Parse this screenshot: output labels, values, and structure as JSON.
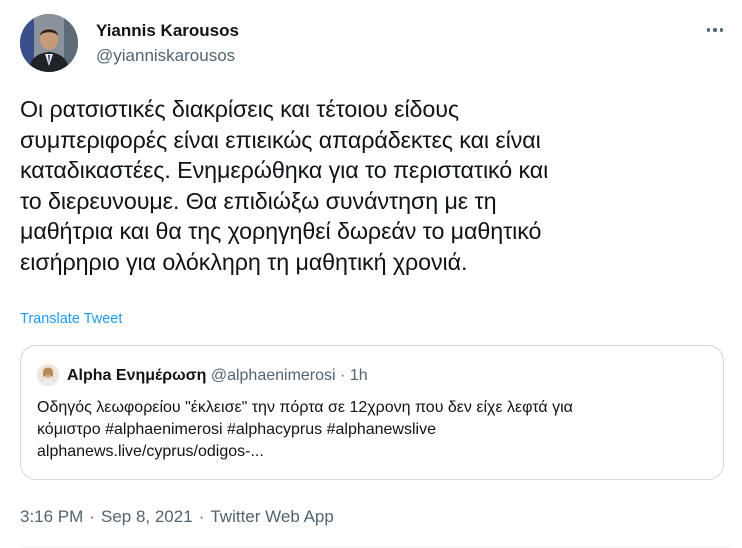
{
  "author": {
    "name": "Yiannis Karousos",
    "handle": "@yianniskarousos"
  },
  "tweet": {
    "text": "Οι ρατσιστικές διακρίσεις και τέτοιου είδους\nσυμπεριφορές είναι επιεικώς απαράδεκτες και είναι\nκαταδικαστέες. Ενημερώθηκα για το περιστατικό και\nτο διερευνουμε. Θα επιδιώξω συνάντηση με τη\nμαθήτρια και θα της χορηγηθεί δωρεάν το μαθητικό\nεισήρηριο για ολόκληρη τη μαθητική χρονιά.",
    "translate_label": "Translate Tweet"
  },
  "quote": {
    "name": "Alpha Ενημέρωση",
    "handle": "@alphaenimerosi",
    "dot": "·",
    "time": "1h",
    "text": "Οδηγός λεωφορείου \"έκλεισε\" την πόρτα σε 12χρονη που δεν είχε λεφτά για\nκόμιστρο #alphaenimerosi #alphacyprus #alphanewslive\nalphanews.live/cyprus/odigos-..."
  },
  "footer": {
    "time": "3:16 PM",
    "sep1": "·",
    "date": "Sep 8, 2021",
    "sep2": "·",
    "source": "Twitter Web App"
  },
  "icons": {
    "more": "more-horizontal-icon"
  },
  "colors": {
    "text": "#0f1419",
    "secondary": "#536471",
    "link": "#1d9bf0",
    "border": "#cfd9de"
  }
}
